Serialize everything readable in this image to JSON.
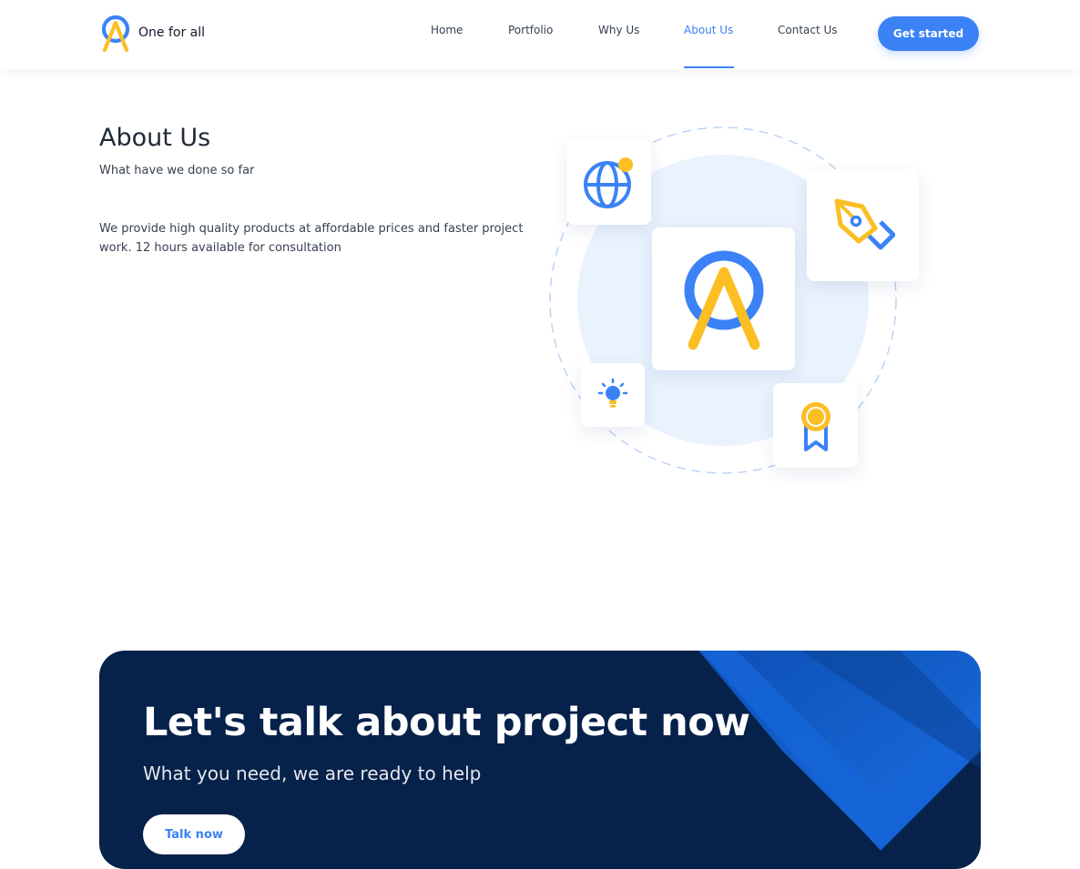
{
  "header": {
    "brand": "One for all",
    "nav": [
      {
        "label": "Home"
      },
      {
        "label": "Portfolio"
      },
      {
        "label": "Why Us"
      },
      {
        "label": "About Us",
        "active": true
      },
      {
        "label": "Contact Us"
      }
    ],
    "cta_label": "Get started"
  },
  "about": {
    "title": "About Us",
    "subtitle": "What have we done so far",
    "body": "We provide high quality products at affordable prices and faster project work. 12 hours available for consultation",
    "illustration_icons": [
      "globe-icon",
      "pen-tool-icon",
      "brand-logo-icon",
      "lightbulb-icon",
      "award-icon"
    ]
  },
  "cta_section": {
    "title": "Let's talk about project now",
    "subtitle": "What you need, we are ready to help",
    "button_label": "Talk now"
  },
  "colors": {
    "accent_blue": "#3b82f6",
    "accent_yellow": "#fbbf24",
    "dark_navy": "#06214a",
    "light_circle": "#eaf2fe"
  }
}
